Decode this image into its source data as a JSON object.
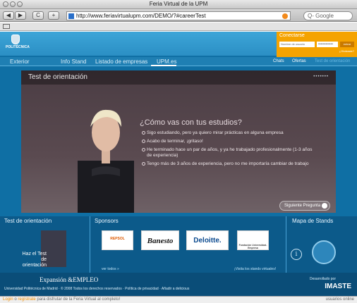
{
  "window": {
    "title": "Feria Virtual de la UPM"
  },
  "browser": {
    "url": "http://www.feriavirtualupm.com/DEMO/?#careerTest",
    "search_placeholder": "Q- Google",
    "back_label": "◀",
    "forward_label": "▶",
    "reload_label": "C",
    "add_label": "+"
  },
  "site": {
    "logo_text": "POLITÉCNICA",
    "login": {
      "title": "Conectarse",
      "user_placeholder": "Nombre de usuario",
      "password_placeholder": "••••••••••••",
      "submit_label": "entrar",
      "forgot_label": "¿Olvidaste?"
    },
    "nav": [
      {
        "label": "Exterior"
      },
      {
        "label": "Info Stand"
      },
      {
        "label": "Listado de empresas"
      },
      {
        "label": "UPM.es"
      }
    ],
    "nav_right": {
      "chats": "Chats",
      "ofertas": "Ofertas",
      "contact": "Test de orientación"
    }
  },
  "stage": {
    "title": "Test de orientación",
    "dots": "•••••••",
    "question": "¿Cómo vas con tus estudios?",
    "options": [
      "Sigo estudiando, pero ya quiero mirar prácticas en alguna empresa",
      "Acabo de terminar, ¡gritaso!",
      "He terminado hace un par de años, y ya he trabajado profesionalmente (1-3 años de experiencia)",
      "Tengo más de 3 años de experiencia, pero no me importaría cambiar de trabajo"
    ],
    "next_label": "Siguiente Pregunta"
  },
  "bottom": {
    "test_title": "Test de orientación",
    "haz_test": "Haz el Test de orientación",
    "sponsors_title": "Sponsors",
    "sponsors": [
      "REPSOL",
      "Banesto",
      "Deloitte.",
      "Fundación Universidad-Empresa"
    ],
    "ver_todos": "ver todos »",
    "visita_stands": "¡Visita los stands virtuales!",
    "mapa_title": "Mapa de Stands"
  },
  "footer": {
    "expansion": "Expansión &EMPLEO",
    "copyright": "Universidad Politécnica de Madrid · © 2008 Todos los derechos reservados · Política de privacidad · Añadir a delicious",
    "dev_label": "Desarrollado por",
    "dev_name": "IMASTE"
  },
  "status": {
    "login": "Login",
    "or": "o",
    "register": "regístrate",
    "tail": "para disfrutar de la Feria Virtual al completo!",
    "right": "usuarios online"
  }
}
